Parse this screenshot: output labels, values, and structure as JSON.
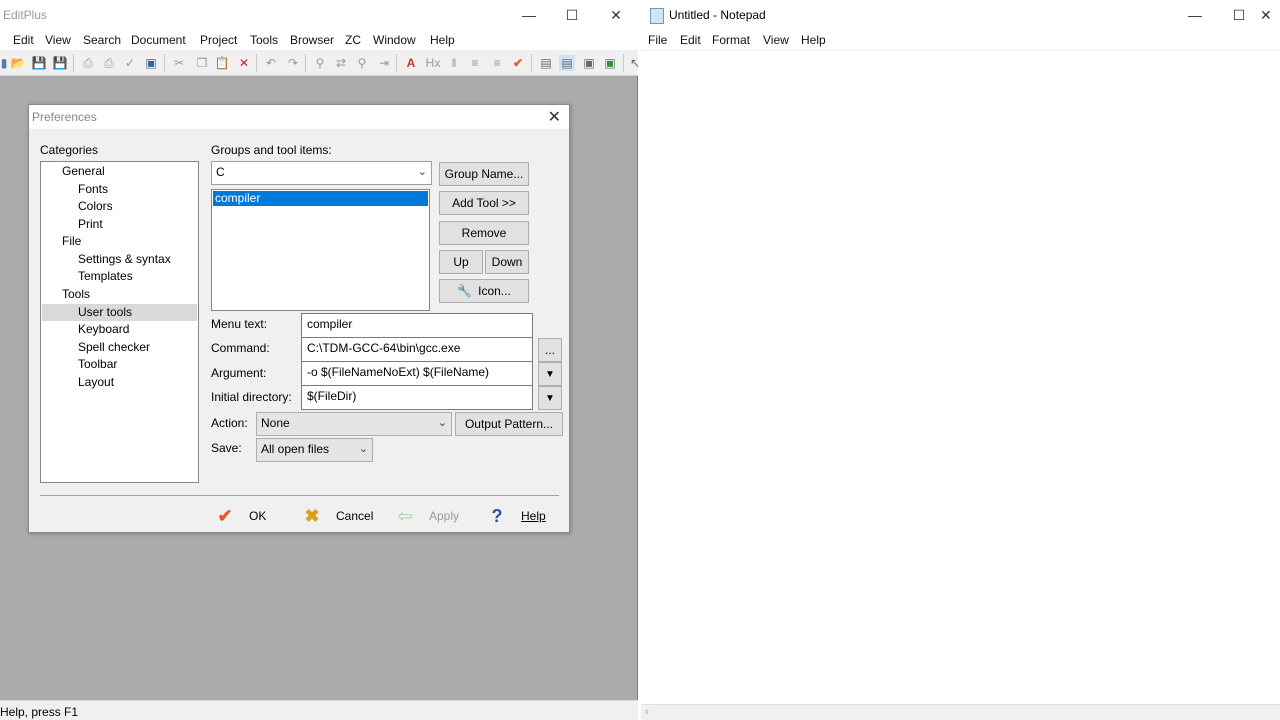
{
  "editplus": {
    "title": "EditPlus",
    "menu": [
      "Edit",
      "View",
      "Search",
      "Document",
      "Project",
      "Tools",
      "Browser",
      "ZC",
      "Window",
      "Help"
    ],
    "status": "Help, press F1"
  },
  "dialog": {
    "title": "Preferences",
    "categories_label": "Categories",
    "categories": [
      {
        "label": "General",
        "level": 0
      },
      {
        "label": "Fonts",
        "level": 1
      },
      {
        "label": "Colors",
        "level": 1
      },
      {
        "label": "Print",
        "level": 1
      },
      {
        "label": "File",
        "level": 0
      },
      {
        "label": "Settings & syntax",
        "level": 1
      },
      {
        "label": "Templates",
        "level": 1
      },
      {
        "label": "Tools",
        "level": 0
      },
      {
        "label": "User tools",
        "level": 1,
        "selected": true
      },
      {
        "label": "Keyboard",
        "level": 1
      },
      {
        "label": "Spell checker",
        "level": 1
      },
      {
        "label": "Toolbar",
        "level": 1
      },
      {
        "label": "Layout",
        "level": 1
      }
    ],
    "groups_label": "Groups and tool items:",
    "group_value": "C",
    "tool_items": [
      "compiler"
    ],
    "buttons": {
      "group_name": "Group Name...",
      "add_tool": "Add Tool >>",
      "remove": "Remove",
      "up": "Up",
      "down": "Down",
      "icon": "Icon...",
      "browse": "...",
      "output_pattern": "Output Pattern..."
    },
    "fields": {
      "menu_text_label": "Menu text:",
      "menu_text": "compiler",
      "command_label": "Command:",
      "command": "C:\\TDM-GCC-64\\bin\\gcc.exe",
      "argument_label": "Argument:",
      "argument": "-o $(FileNameNoExt) $(FileName)",
      "initdir_label": "Initial directory:",
      "initdir": "$(FileDir)",
      "action_label": "Action:",
      "action": "None",
      "save_label": "Save:",
      "save": "All open files"
    },
    "footer": {
      "ok": "OK",
      "cancel": "Cancel",
      "apply": "Apply",
      "help": "Help"
    }
  },
  "notepad": {
    "title": "Untitled - Notepad",
    "menu": [
      "File",
      "Edit",
      "Format",
      "View",
      "Help"
    ]
  },
  "colors": {
    "selection": "#0078d7",
    "workspace": "#ababab",
    "ok_check": "#e8552b"
  }
}
